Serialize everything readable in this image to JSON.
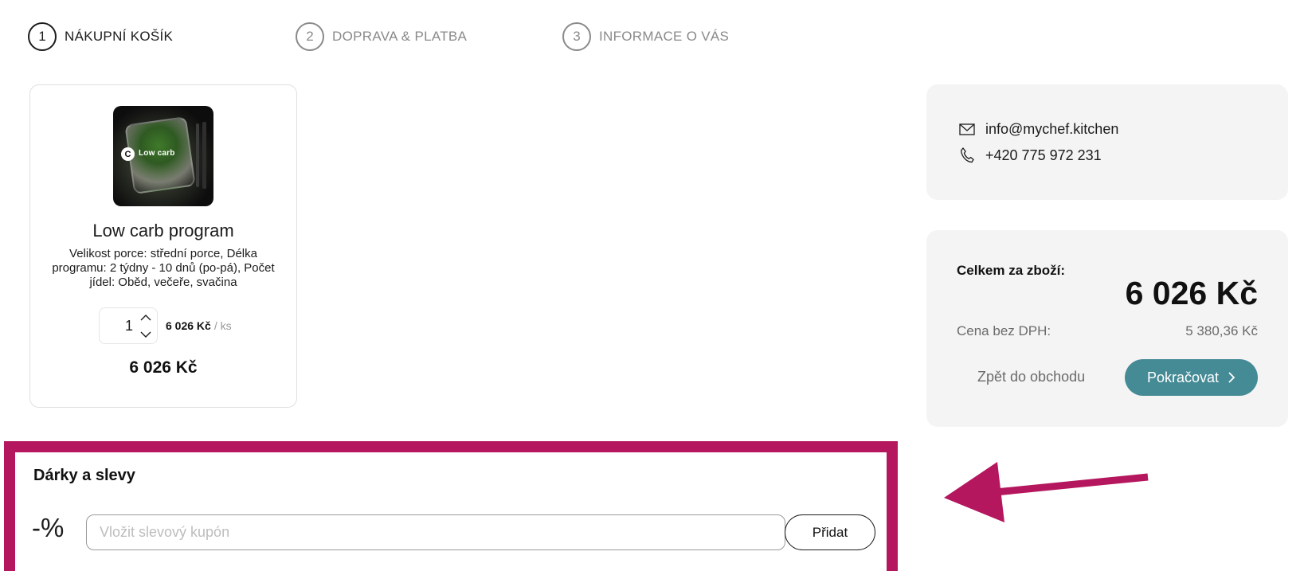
{
  "steps": [
    {
      "number": "1",
      "label": "NÁKUPNÍ KOŠÍK",
      "active": true
    },
    {
      "number": "2",
      "label": "DOPRAVA & PLATBA",
      "active": false
    },
    {
      "number": "3",
      "label": "INFORMACE O VÁS",
      "active": false
    }
  ],
  "product": {
    "image_badge": "Low carb",
    "image_logo": "C",
    "name": "Low carb program",
    "description": "Velikost porce: střední porce, Délka programu: 2 týdny - 10 dnů (po-pá), Počet jídel: Oběd, večeře, svačina",
    "quantity": "1",
    "unit_price": "6 026 Kč",
    "unit_suffix": "/ ks",
    "total": "6 026 Kč"
  },
  "contact": {
    "email": "info@mychef.kitchen",
    "phone": "+420 775 972 231",
    "email_icon": "envelope-icon",
    "phone_icon": "phone-icon"
  },
  "summary": {
    "title": "Celkem za zboží:",
    "total": "6 026 Kč",
    "net_label": "Cena bez DPH:",
    "net_value": "5 380,36 Kč",
    "back_label": "Zpět do obchodu",
    "continue_label": "Pokračovat"
  },
  "discount": {
    "title": "Dárky a slevy",
    "icon_text": "-%",
    "input_value": "",
    "input_placeholder": "Vložit slevový kupón",
    "add_label": "Přidat"
  },
  "colors": {
    "accent": "#458b96",
    "highlight": "#b5175f",
    "panel": "#f4f4f4"
  }
}
